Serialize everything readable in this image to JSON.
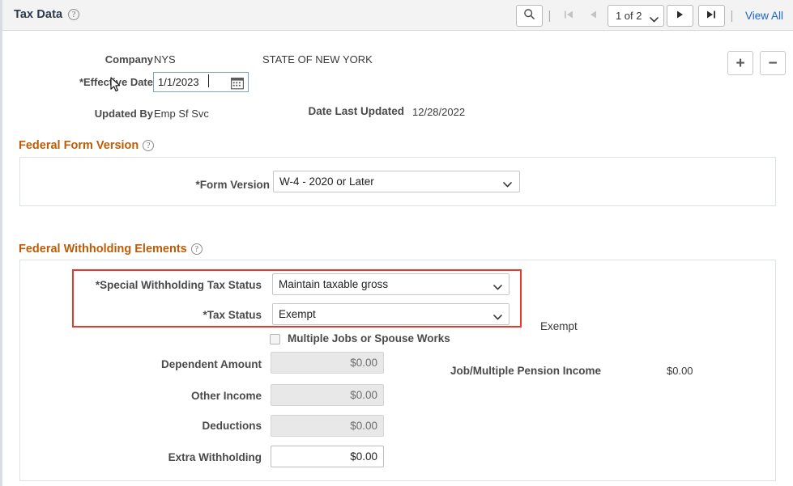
{
  "header": {
    "title": "Tax Data",
    "help_icon": "help-icon",
    "search_icon": "search-icon",
    "separator": "|",
    "first_icon": "first-page-icon",
    "prev_icon": "previous-page-icon",
    "page_indicator": "1 of 2",
    "next_icon": "next-page-icon",
    "last_icon": "last-page-icon",
    "view_all": "View All"
  },
  "record": {
    "company_label": "Company",
    "company_value": "NYS",
    "company_description": "STATE OF NEW YORK",
    "effective_date_label": "*Effective Date",
    "effective_date_value": "1/1/2023",
    "calendar_icon": "calendar-icon",
    "updated_by_label": "Updated By",
    "updated_by_value": "Emp Sf Svc",
    "date_last_updated_label": "Date Last Updated",
    "date_last_updated_value": "12/28/2022",
    "add_row_label": "+",
    "delete_row_label": "−"
  },
  "form_version_section": {
    "title": "Federal Form Version",
    "form_version_label": "*Form Version",
    "form_version_value": "W-4 - 2020 or Later"
  },
  "withholding_section": {
    "title": "Federal Withholding Elements",
    "special_status_label": "*Special Withholding Tax Status",
    "special_status_value": "Maintain taxable gross",
    "tax_status_label": "*Tax Status",
    "tax_status_value": "Exempt",
    "exempt_text": "Exempt",
    "multiple_jobs_label": "Multiple Jobs or Spouse Works",
    "dependent_amount_label": "Dependent Amount",
    "dependent_amount_value": "$0.00",
    "other_income_label": "Other Income",
    "other_income_value": "$0.00",
    "deductions_label": "Deductions",
    "deductions_value": "$0.00",
    "extra_withholding_label": "Extra Withholding",
    "extra_withholding_value": "$0.00",
    "pension_income_label": "Job/Multiple Pension Income",
    "pension_income_value": "$0.00"
  },
  "colors": {
    "section_heading": "#bf5b04",
    "highlight_border": "#e8392f",
    "link": "#1c64d1",
    "header_bg": "#f3f3f3"
  }
}
